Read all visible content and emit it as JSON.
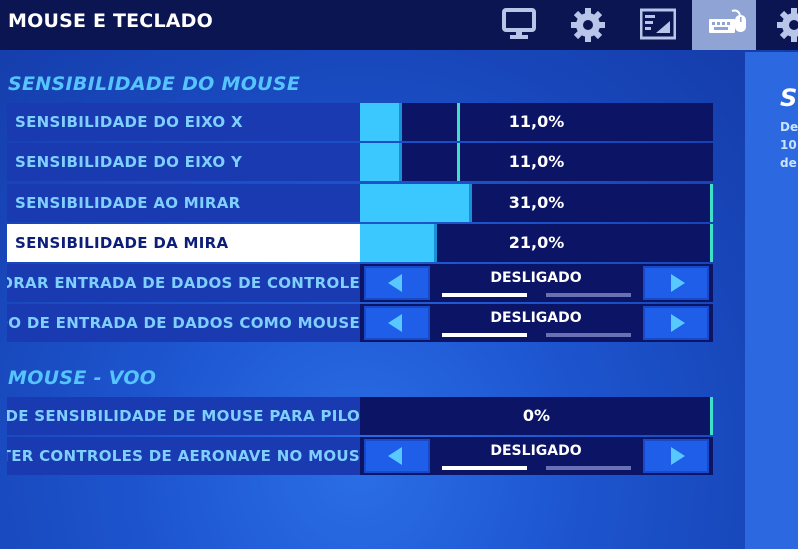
{
  "header": {
    "title": "MOUSE E TECLADO",
    "tabs": [
      {
        "name": "monitor-icon"
      },
      {
        "name": "gear-icon"
      },
      {
        "name": "hud-layout-icon"
      },
      {
        "name": "keyboard-mouse-icon",
        "active": true
      },
      {
        "name": "controller-settings-icon"
      }
    ]
  },
  "sections": {
    "mouse_sensitivity": "SENSIBILIDADE DO MOUSE",
    "mouse_flight": "MOUSE - VOO"
  },
  "settings": {
    "x_axis": {
      "label": "SENSIBILIDADE DO EIXO X",
      "value": "11,0%",
      "level": 0.11
    },
    "y_axis": {
      "label": "SENSIBILIDADE DO EIXO Y",
      "value": "11,0%",
      "level": 0.11
    },
    "targeting": {
      "label": "SENSIBILIDADE AO MIRAR",
      "value": "31,0%",
      "level": 0.31
    },
    "scope": {
      "label": "SENSIBILIDADE DA MIRA",
      "value": "21,0%",
      "level": 0.21
    },
    "ignore_controller": {
      "label": "GNORAR ENTRADA DE DADOS DE CONTROLE",
      "value": "DESLIGADO"
    },
    "input_mode": {
      "label": "ODO DE ENTRADA DE DADOS COMO MOUSE",
      "value": "DESLIGADO"
    },
    "flight_multiplier": {
      "label": "R DE SENSIBILIDADE DE MOUSE PARA PILO",
      "value": "0%",
      "level": 0.0
    },
    "invert_aircraft": {
      "label": "RTER CONTROLES DE AERONAVE NO MOUS",
      "value": "DESLIGADO"
    }
  },
  "info_panel": {
    "title": "S",
    "text_lines": [
      "De",
      "10",
      "de"
    ]
  },
  "colors": {
    "accent": "#3ac8ff",
    "header_bg": "#0a1552",
    "selected_row": "#ffffff"
  }
}
